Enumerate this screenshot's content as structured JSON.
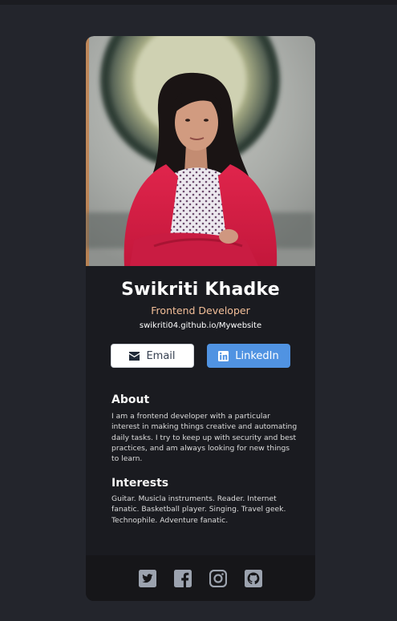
{
  "profile": {
    "name": "Swikriti Khadke",
    "role": "Frontend Developer",
    "website": "swikriti04.github.io/Mywebsite",
    "photo_icon": "profile-photo"
  },
  "buttons": {
    "email_label": "Email",
    "linkedin_label": "LinkedIn"
  },
  "about": {
    "title": "About",
    "text": "I am a frontend developer with a particular interest in making things creative and automating daily tasks. I try to keep up with security and best practices, and am always looking for new things to learn."
  },
  "interests": {
    "title": "Interests",
    "text": "Guitar. Musicla instruments. Reader. Internet fanatic. Basketball player. Singing. Travel geek. Technophile. Adventure fanatic."
  },
  "footer": {
    "icons": [
      "twitter-icon",
      "facebook-icon",
      "instagram-icon",
      "github-icon"
    ]
  },
  "colors": {
    "background": "#23252c",
    "card": "#1a1b20",
    "role": "#f3bf99",
    "linkedin": "#5093e2",
    "footer": "#161619",
    "footer_icon": "#9ca3af"
  }
}
